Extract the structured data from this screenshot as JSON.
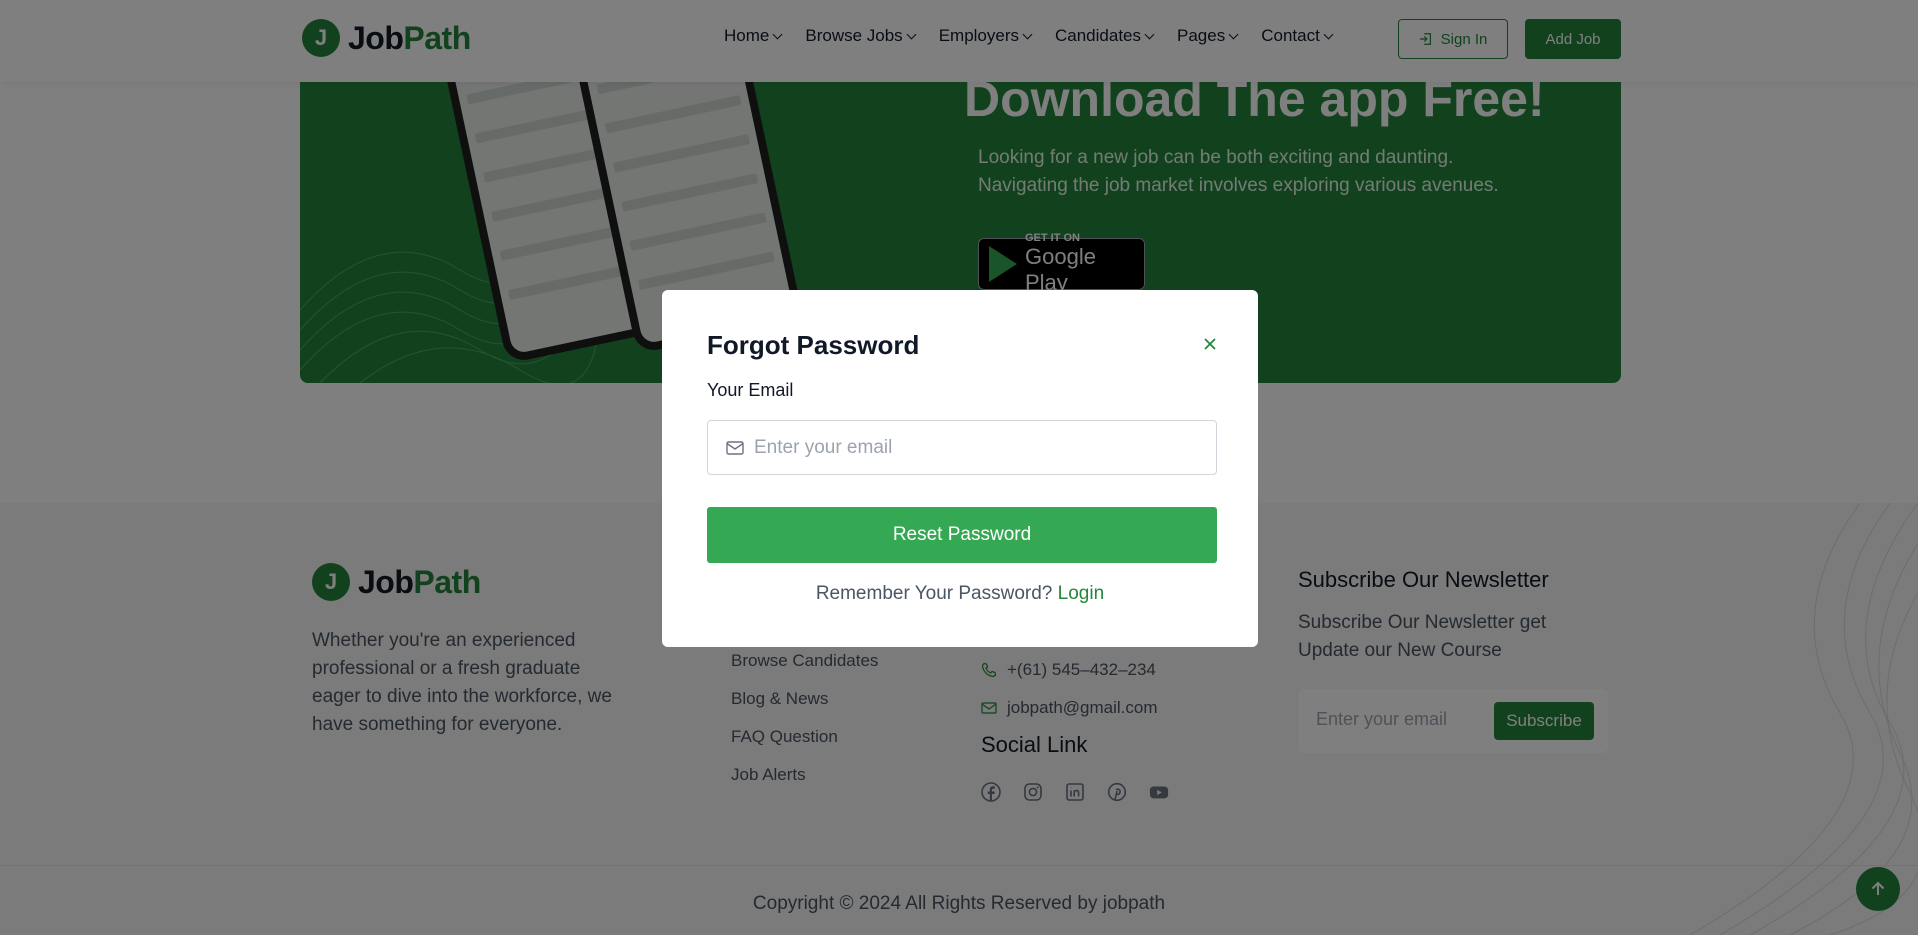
{
  "header": {
    "logo": {
      "letter": "J",
      "word_a": "Job",
      "word_b": "Path"
    },
    "nav": [
      {
        "label": "Home"
      },
      {
        "label": "Browse Jobs"
      },
      {
        "label": "Employers"
      },
      {
        "label": "Candidates"
      },
      {
        "label": "Pages"
      },
      {
        "label": "Contact"
      }
    ],
    "sign_in": "Sign In",
    "add_job": "Add Job"
  },
  "banner": {
    "title": "Download The app Free!",
    "text": "Looking for a new job can be both exciting and daunting. Navigating the job market involves exploring various avenues.",
    "store_small": "GET IT ON",
    "store_big": "Google Play"
  },
  "footer": {
    "logo": {
      "letter": "J",
      "word_a": "Job",
      "word_b": "Path"
    },
    "about": "Whether you're an experienced professional or a fresh graduate eager to dive into the workforce, we have something for everyone.",
    "links": [
      "Browse Candidates",
      "Blog & News",
      "FAQ Question",
      "Job Alerts"
    ],
    "phone": "+(61) 545–432–234",
    "email": "jobpath@gmail.com",
    "social_title": "Social Link",
    "social_icons": [
      "facebook-icon",
      "instagram-icon",
      "linkedin-icon",
      "pinterest-icon",
      "youtube-icon"
    ],
    "newsletter_title": "Subscribe Our Newsletter",
    "newsletter_text": "Subscribe Our Newsletter get Update our New Course",
    "newsletter_placeholder": "Enter your email",
    "subscribe": "Subscribe",
    "copyright": "Copyright © 2024 All Rights Reserved by jobpath"
  },
  "modal": {
    "title": "Forgot Password",
    "email_label": "Your Email",
    "email_placeholder": "Enter your email",
    "email_value": "",
    "button": "Reset Password",
    "remember_text": "Remember Your Password?",
    "login_link": "Login"
  },
  "colors": {
    "brand": "#25853b",
    "button": "#34a853",
    "overlay": "rgba(0,0,0,0.5)"
  }
}
